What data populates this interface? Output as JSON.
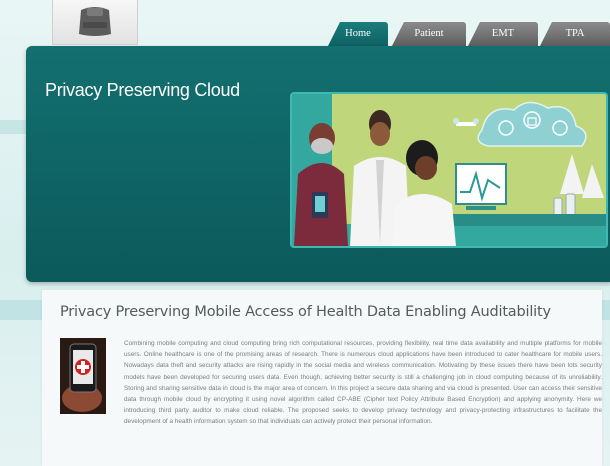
{
  "nav": {
    "tabs": [
      {
        "label": "Home",
        "active": true
      },
      {
        "label": "Patient",
        "active": false
      },
      {
        "label": "EMT",
        "active": false
      },
      {
        "label": "TPA",
        "active": false
      }
    ]
  },
  "header": {
    "site_title": "Privacy Preserving Cloud"
  },
  "main": {
    "heading": "Privacy Preserving Mobile Access of Health Data Enabling Auditability",
    "intro": "Combining mobile computing and cloud computing bring rich computational resources, providing flexibility, real time data availability and multiple platforms for mobile users. Online healthcare is one of the promising areas of research. There is numerous cloud applications have been introduced to cater healthcare for mobile users. Nowadays data theft and security attacks are rising rapidly in the social media and wireless communication. Motivating by these issues there have been lots security models have been developed for securing users data. Even though, achieving better security is still a challenging job in cloud computing because of its unreliability. Storing and sharing sensitive data in cloud is the major area of concern. In this project a secure data sharing and via cloud is presented. User can access their sensitive data through mobile cloud by encrypting it using novel algorithm called CP-ABE (Cipher text Policy Attribute Based Encryption) and applying anonymity. Here we introducing third party auditor to make cloud reliable. The proposed seeks to develop privacy technology and privacy-protecting infrastructures to facilitate the development of a health information system so that individuals can actively protect their personal information."
  },
  "colors": {
    "teal_dark": "#0f6465",
    "teal_tab": "#1b7d7d",
    "tab_gray": "#6e6e6e",
    "heading_text": "#555a5a",
    "body_text": "#7a7f7f"
  },
  "icons": {
    "logo": "device-icon",
    "content_image": "medical-phone-icon"
  }
}
